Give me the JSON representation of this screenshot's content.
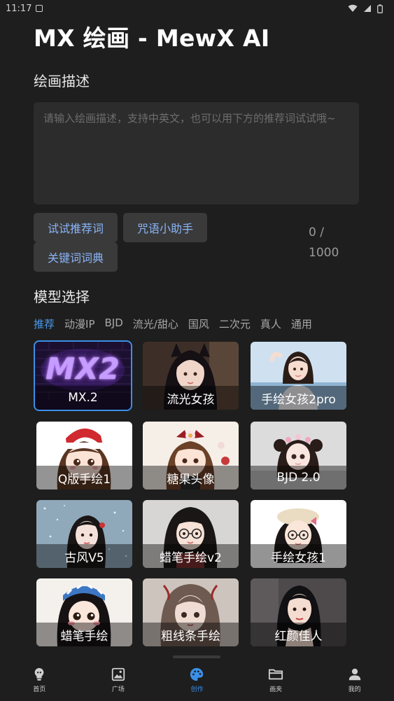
{
  "status_bar": {
    "time": "11:17"
  },
  "header": {
    "title": "MX 绘画 - MewX AI"
  },
  "description": {
    "section_title": "绘画描述",
    "placeholder": "请输入绘画描述，支持中英文，也可以用下方的推荐词试试哦~",
    "value": ""
  },
  "helpers": {
    "try_recommend": "试试推荐词",
    "spell_assistant": "咒语小助手",
    "keyword_dict": "关键词词典"
  },
  "counter": {
    "current": "0 /",
    "max": "1000"
  },
  "model": {
    "section_title": "模型选择",
    "categories": [
      "推荐",
      "动漫IP",
      "BJD",
      "流光/甜心",
      "国风",
      "二次元",
      "真人",
      "通用"
    ],
    "active_category": "推荐",
    "items": [
      {
        "label": "MX.2",
        "art": "MX2",
        "selected": true
      },
      {
        "label": "流光女孩"
      },
      {
        "label": "手绘女孩2pro"
      },
      {
        "label": "Q版手绘1"
      },
      {
        "label": "糖果头像"
      },
      {
        "label": "BJD 2.0"
      },
      {
        "label": "古风V5"
      },
      {
        "label": "蜡笔手绘v2"
      },
      {
        "label": "手绘女孩1"
      },
      {
        "label": "蜡笔手绘"
      },
      {
        "label": "粗线条手绘"
      },
      {
        "label": "红颜佳人"
      }
    ]
  },
  "bottom_nav": {
    "items": [
      {
        "label": "首页",
        "icon": "lightbulb-icon"
      },
      {
        "label": "广场",
        "icon": "image-icon"
      },
      {
        "label": "创作",
        "icon": "palette-icon",
        "active": true
      },
      {
        "label": "画夹",
        "icon": "folder-icon"
      },
      {
        "label": "我的",
        "icon": "person-icon"
      }
    ]
  },
  "colors": {
    "accent": "#3b8fe8",
    "chip_text": "#8ab4f8",
    "background": "#1e1e1e"
  }
}
